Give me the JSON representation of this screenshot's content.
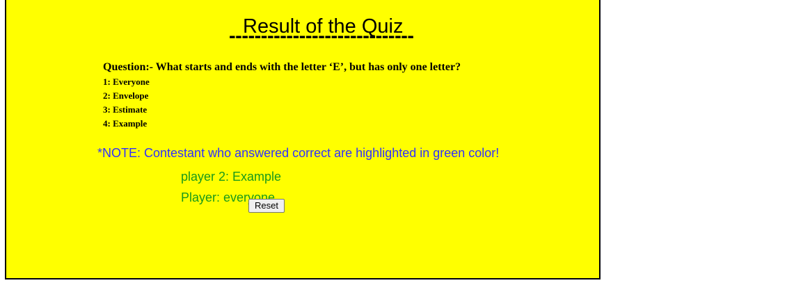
{
  "quiz": {
    "title": "Result of the Quiz",
    "title_rule": "-----------------------------",
    "question": "Question:- What starts and ends with the letter ‘E’, but has only one letter?",
    "options": [
      "1: Everyone",
      "2: Envelope",
      "3: Estimate",
      "4: Example"
    ],
    "note": "*NOTE: Contestant who answered correct are highlighted in green color!",
    "players": [
      "player 2: Example",
      "Player: everyone"
    ],
    "reset_label": "Reset"
  },
  "colors": {
    "panel_background": "#ffff00",
    "note_text": "#3030ff",
    "correct_answer": "#1a9a1a"
  }
}
